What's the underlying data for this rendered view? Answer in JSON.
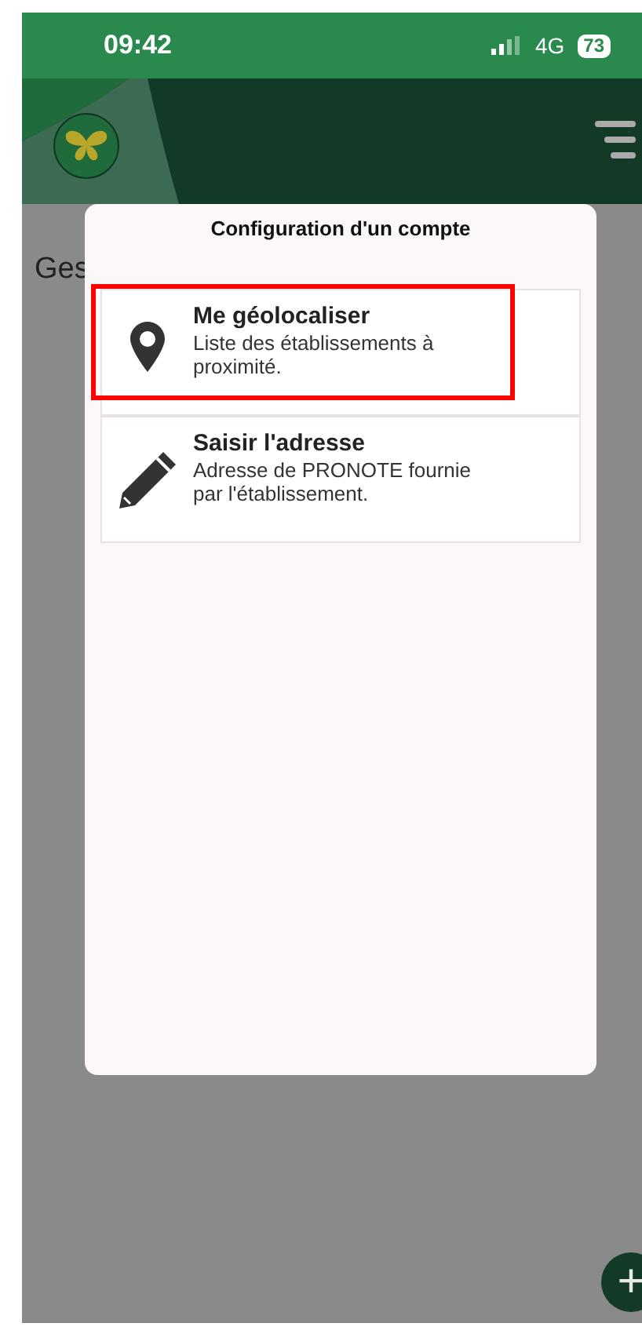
{
  "status_bar": {
    "time": "09:42",
    "network": "4G",
    "battery": "73"
  },
  "page": {
    "title_fragment": "Ges"
  },
  "dialog": {
    "title": "Configuration d'un compte",
    "options": [
      {
        "kind": "locate",
        "title": "Me géolocaliser",
        "description": "Liste des établissements à proximité.",
        "highlighted": true
      },
      {
        "kind": "address",
        "title": "Saisir l'adresse",
        "description": "Adresse de PRONOTE fournie par l'établissement.",
        "highlighted": false
      }
    ]
  },
  "fab": {
    "label": "+"
  }
}
